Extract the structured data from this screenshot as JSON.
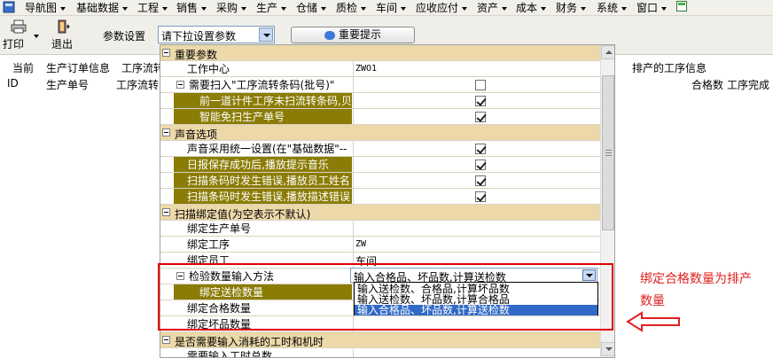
{
  "menubar": {
    "items": [
      {
        "label": "导航图"
      },
      {
        "label": "基础数据"
      },
      {
        "label": "工程"
      },
      {
        "label": "销售"
      },
      {
        "label": "采购"
      },
      {
        "label": "生产"
      },
      {
        "label": "仓储"
      },
      {
        "label": "质检"
      },
      {
        "label": "车间"
      },
      {
        "label": "应收应付"
      },
      {
        "label": "资产"
      },
      {
        "label": "成本"
      },
      {
        "label": "财务"
      },
      {
        "label": "系统"
      },
      {
        "label": "窗口"
      }
    ]
  },
  "toolbar": {
    "print_label": "打印",
    "exit_label": "退出",
    "param_label": "参数设置",
    "param_select_value": "请下拉设置参数",
    "tip_button_label": "重要提示"
  },
  "grid": {
    "header1": [
      "当前",
      "生产订单信息",
      "工序流转",
      "排产的工序信息"
    ],
    "header2": [
      "ID",
      "生产单号",
      "工序流转",
      "合格数",
      "工序完成"
    ]
  },
  "panel": {
    "rows": [
      {
        "kind": "cat",
        "label": "重要参数"
      },
      {
        "kind": "prop",
        "label": "工作中心",
        "value": "ZWO1"
      },
      {
        "kind": "group",
        "label": "需要扫入\"工序流转条码(批号)\"",
        "checked": false
      },
      {
        "kind": "prop",
        "label": "前一道计件工序未扫流转条码,贝",
        "checked": true,
        "hl": true
      },
      {
        "kind": "prop",
        "label": "智能免扫生产单号",
        "checked": true,
        "hl": true
      },
      {
        "kind": "cat",
        "label": "声音选项"
      },
      {
        "kind": "prop",
        "label": "声音采用统一设置(在\"基础数据\"--",
        "checked": true
      },
      {
        "kind": "prop",
        "label": "日报保存成功后,播放提示音乐",
        "checked": true,
        "hl": true
      },
      {
        "kind": "prop",
        "label": "扫描条码时发生错误,播放员工姓名",
        "checked": true,
        "hl": true
      },
      {
        "kind": "prop",
        "label": "扫描条码时发生错误,播放描述错误",
        "checked": true,
        "hl": true
      },
      {
        "kind": "cat",
        "label": "扫描绑定值(为空表示不默认)"
      },
      {
        "kind": "prop",
        "label": "绑定生产单号",
        "value": ""
      },
      {
        "kind": "prop",
        "label": "绑定工序",
        "value": "ZW"
      },
      {
        "kind": "prop",
        "label": "绑定员工",
        "value": "车间"
      },
      {
        "kind": "group",
        "label": "检验数量输入方法",
        "value": ""
      },
      {
        "kind": "prop",
        "label": "绑定送检数量",
        "value": "",
        "hl": true
      },
      {
        "kind": "prop",
        "label": "绑定合格数量",
        "value": ""
      },
      {
        "kind": "prop",
        "label": "绑定坏品数量",
        "value": ""
      },
      {
        "kind": "cat",
        "label": "是否需要输入消耗的工时和机时"
      },
      {
        "kind": "prop",
        "label": "需要输入工时总数",
        "value": ""
      }
    ]
  },
  "dropdown": {
    "selected": "输入合格品、坏品数,计算送检数",
    "options": [
      "输入送检数、合格品,计算坏品数",
      "输入送检数、坏品数,计算合格品",
      "输入合格品、坏品数,计算送检数"
    ]
  },
  "annotation": {
    "line1": "绑定合格数量为排产",
    "line2": "数量"
  },
  "colors": {
    "highlight": "#8b7c06",
    "category": "#ecd8a9",
    "annotation": "#e02020",
    "selection": "#3169c6"
  }
}
